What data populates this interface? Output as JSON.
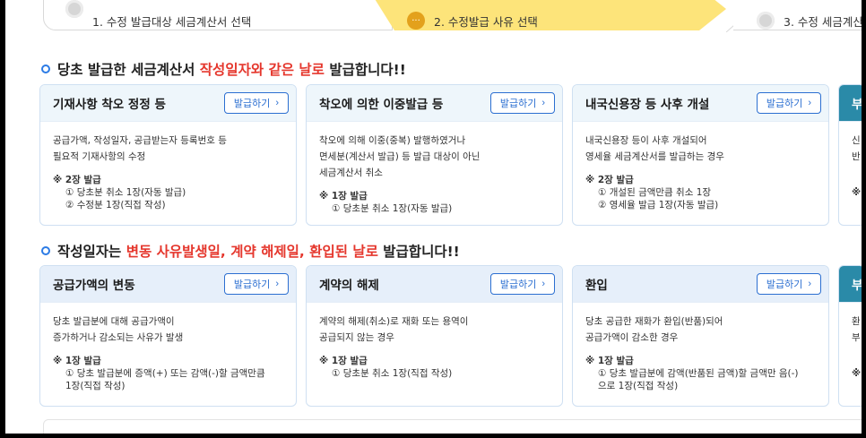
{
  "stepper": {
    "steps": [
      {
        "num": "1.",
        "label": "1. 수정 발급대상 세금계산서 선택"
      },
      {
        "num": "···",
        "label": "2. 수정발급 사유 선택"
      },
      {
        "num": "3.",
        "label": "3. 수정 세금계산서 작"
      }
    ]
  },
  "section1": {
    "prefix": "당초 발급한 세금계산서 ",
    "highlight": "작성일자와 같은 날로",
    "suffix": " 발급합니다!!"
  },
  "section2": {
    "prefix": "작성일자는 ",
    "highlight": "변동 사유발생일, 계약 해제일, 환입된 날로",
    "suffix": " 발급합니다!!"
  },
  "issue_label": "발급하기",
  "row1": [
    {
      "title": "기재사항 착오 정정 등",
      "desc": [
        "공급가액, 작성일자, 공급받는자 등록번호 등",
        "필요적 기재사항의 수정"
      ],
      "note_title": "※ 2장 발급",
      "note_items": [
        "① 당초분 취소 1장(자동 발급)",
        "② 수정분 1장(직접 작성)"
      ]
    },
    {
      "title": "착오에 의한 이중발급 등",
      "desc": [
        "착오에 의해 이중(중복) 발행하였거나",
        "면세분(계산서 발급) 등 발급 대상이 아닌",
        "세금계산서 취소"
      ],
      "note_title": "※ 1장 발급",
      "note_items": [
        "① 당초분 취소 1장(자동 발급)"
      ]
    },
    {
      "title": "내국신용장 등 사후 개설",
      "desc": [
        "내국신용장 등이 사후 개설되어",
        "영세율 세금계산서를 발급하는 경우"
      ],
      "note_title": "※ 2장 발급",
      "note_items": [
        "① 개설된 금액만큼 취소 1장",
        "② 영세율 발급 1장(자동 발급)"
      ]
    }
  ],
  "row1_partial": {
    "title": "부",
    "desc": [
      "신",
      "반"
    ],
    "note": "※"
  },
  "row2": [
    {
      "title": "공급가액의 변동",
      "desc": [
        "당초 발급분에 대해 공급가액이",
        "증가하거나 감소되는 사유가 발생"
      ],
      "note_title": "※ 1장 발급",
      "note_items": [
        "① 당초 발급분에 증액(+) 또는 감액(-)할 금액만큼",
        "1장(직접 작성)"
      ]
    },
    {
      "title": "계약의 해제",
      "desc": [
        "계약의 해제(취소)로 재화 또는 용역이",
        "공급되지 않는 경우"
      ],
      "note_title": "※ 1장 발급",
      "note_items": [
        "① 당초분 취소 1장(직접 작성)"
      ]
    },
    {
      "title": "환입",
      "desc": [
        "당초 공급한 재화가 환입(반품)되어",
        "공급가액이 감소한 경우"
      ],
      "note_title": "※ 1장 발급",
      "note_items": [
        "① 당초 발급분에 감액(반품된 금액)할 금액만 음(-)",
        "으로 1장(직접 작성)"
      ]
    }
  ],
  "row2_partial": {
    "title": "부",
    "desc": [
      "환",
      "부"
    ],
    "note": "※"
  }
}
